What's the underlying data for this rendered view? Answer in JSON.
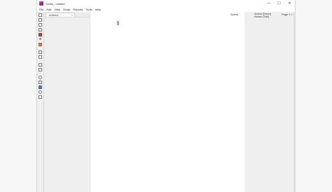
{
  "window": {
    "title": "Trelby - untitled",
    "controls": {
      "minimize": "—",
      "maximize": "☐",
      "close": "✕"
    }
  },
  "menu": [
    "File",
    "Edit",
    "View",
    "Script",
    "Reports",
    "Tools",
    "Help"
  ],
  "tabs": [
    {
      "label": "untitled",
      "close": "×"
    }
  ],
  "panel": {
    "source_label": "Scene",
    "action_hint_1": "Action [Enter]",
    "action_hint_2": "Action [Tab]",
    "page_indicator": "Page 1 / 1"
  },
  "colors": {
    "accent": "#6a74d8",
    "logo_start": "#d52d6d",
    "logo_end": "#6a2bd1"
  },
  "toolbar_icons": [
    "new-file-icon",
    "open-file-icon",
    "save-icon",
    "save-as-icon",
    "close-script-icon",
    "settings-icon",
    "script-settings-icon",
    "reports-icon",
    "undo-icon",
    "redo-icon",
    "find-icon",
    "spellcheck-icon",
    "characters-icon",
    "help-icon",
    "quit-icon"
  ]
}
